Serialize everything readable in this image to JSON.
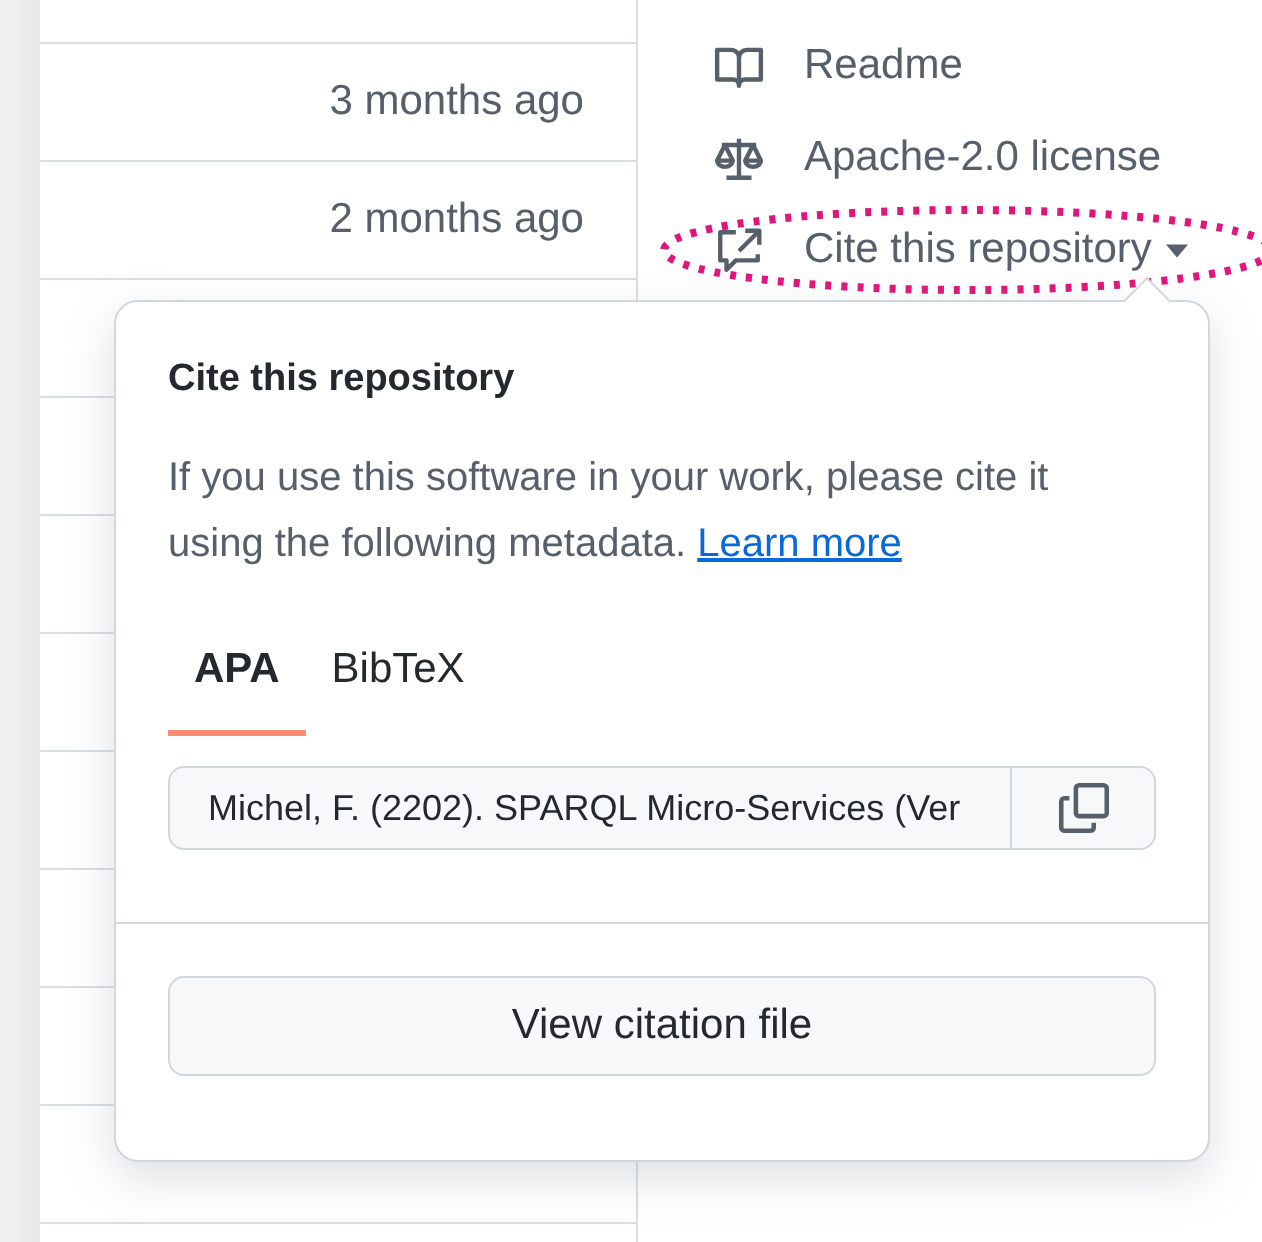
{
  "table": {
    "rows": [
      {
        "time": "3 months ago"
      },
      {
        "time": "2 months ago"
      }
    ]
  },
  "sidebar": {
    "items": [
      {
        "kind": "readme",
        "label": "Readme"
      },
      {
        "kind": "license",
        "label": "Apache-2.0 license"
      },
      {
        "kind": "cite",
        "label": "Cite this repository",
        "expanded": true,
        "highlighted": true
      }
    ]
  },
  "popover": {
    "title": "Cite this repository",
    "description": "If you use this software in your work, please cite it using the following metadata.",
    "link": "Learn more",
    "tabs": [
      {
        "label": "APA",
        "selected": true
      },
      {
        "label": "BibTeX",
        "selected": false
      }
    ],
    "citation": "Michel, F. (2202). SPARQL Micro-Services (Ver",
    "button": "View citation file"
  }
}
